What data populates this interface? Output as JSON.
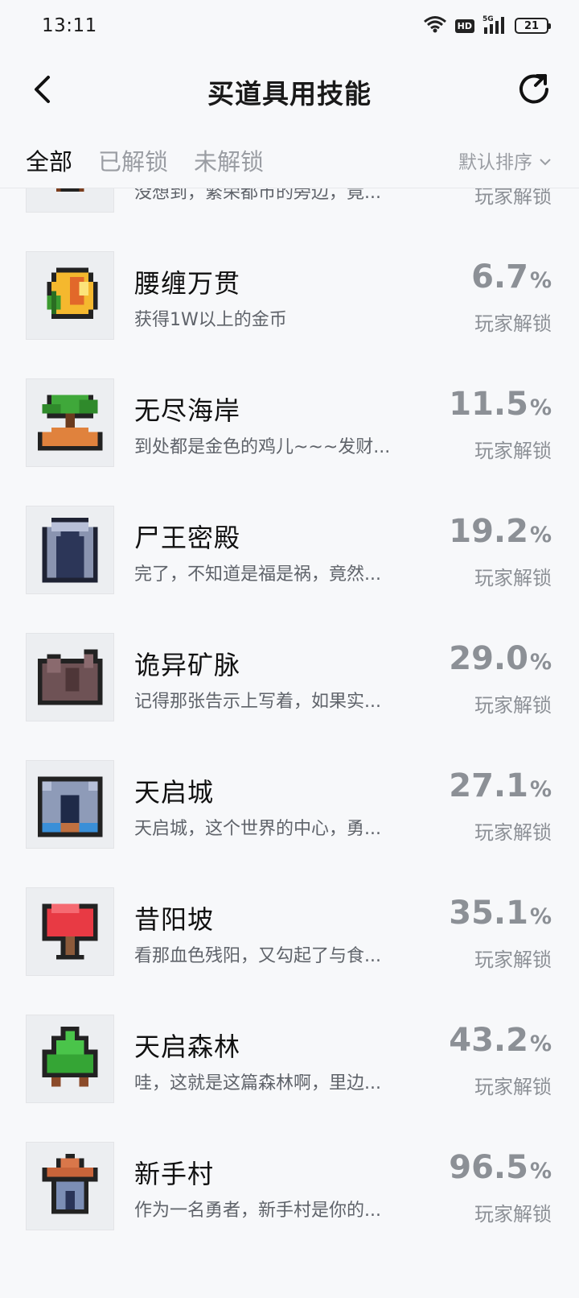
{
  "status_bar": {
    "time": "13:11",
    "network": "5G",
    "hd": "HD",
    "battery": "21"
  },
  "header": {
    "title": "买道具用技能",
    "back_icon": "back-arrow-icon",
    "refresh_icon": "share-refresh-icon"
  },
  "tabs": [
    {
      "label": "全部",
      "active": true
    },
    {
      "label": "已解锁",
      "active": false
    },
    {
      "label": "未解锁",
      "active": false
    }
  ],
  "sort": {
    "label": "默认排序"
  },
  "items": [
    {
      "name": "",
      "desc": "没想到，繁荣都市的旁边，竟...",
      "rate": "",
      "sub": "玩家解锁",
      "icon": "city-outskirts-icon"
    },
    {
      "name": "腰缠万贯",
      "desc": "获得1W以上的金币",
      "rate": "6.7",
      "sub": "玩家解锁",
      "icon": "gold-coin-icon"
    },
    {
      "name": "无尽海岸",
      "desc": "到处都是金色的鸡儿~~~发财...",
      "rate": "11.5",
      "sub": "玩家解锁",
      "icon": "palm-island-icon"
    },
    {
      "name": "尸王密殿",
      "desc": "完了，不知道是福是祸，竟然...",
      "rate": "19.2",
      "sub": "玩家解锁",
      "icon": "stone-gate-icon"
    },
    {
      "name": "诡异矿脉",
      "desc": "记得那张告示上写着，如果实...",
      "rate": "29.0",
      "sub": "玩家解锁",
      "icon": "ore-rock-icon"
    },
    {
      "name": "天启城",
      "desc": "天启城，这个世界的中心，勇...",
      "rate": "27.1",
      "sub": "玩家解锁",
      "icon": "castle-icon"
    },
    {
      "name": "昔阳坡",
      "desc": "看那血色残阳，又勾起了与食...",
      "rate": "35.1",
      "sub": "玩家解锁",
      "icon": "red-tree-icon"
    },
    {
      "name": "天启森林",
      "desc": "哇，这就是这篇森林啊，里边...",
      "rate": "43.2",
      "sub": "玩家解锁",
      "icon": "green-tree-icon"
    },
    {
      "name": "新手村",
      "desc": "作为一名勇者，新手村是你的...",
      "rate": "96.5",
      "sub": "玩家解锁",
      "icon": "village-hut-icon"
    }
  ],
  "percent_sign": "%"
}
